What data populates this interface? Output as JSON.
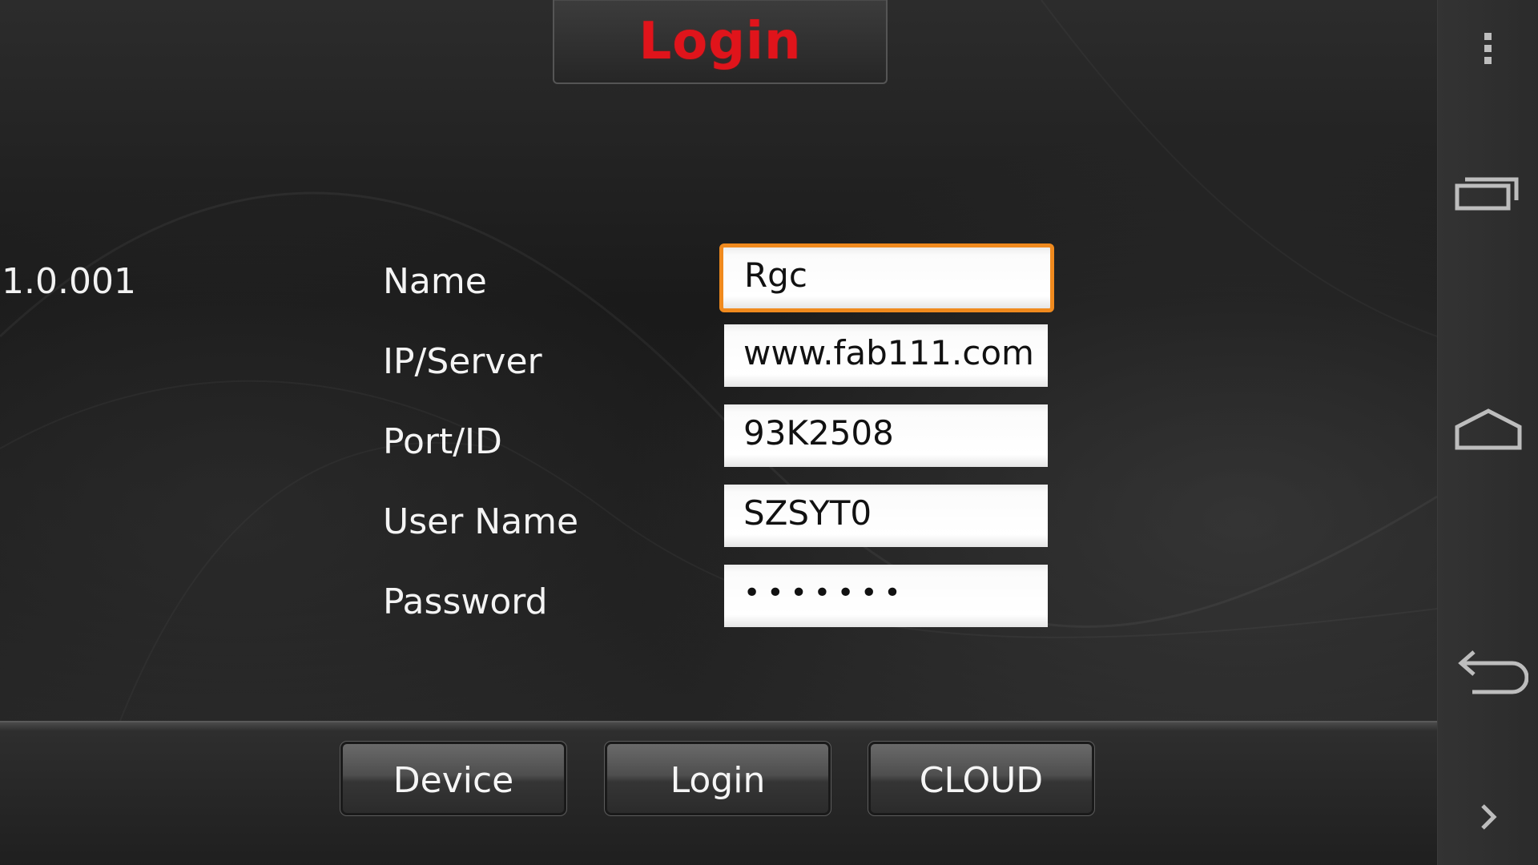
{
  "header": {
    "title": "Login"
  },
  "version": "1.0.001",
  "form": {
    "fields": [
      {
        "label": "Name",
        "value": "Rgc"
      },
      {
        "label": "IP/Server",
        "value": "www.fab111.com"
      },
      {
        "label": "Port/ID",
        "value": "93K2508"
      },
      {
        "label": "User Name",
        "value": "SZSYT0"
      },
      {
        "label": "Password",
        "value": "•••••••"
      }
    ],
    "focused_field": "Name"
  },
  "toolbar": {
    "device_label": "Device",
    "login_label": "Login",
    "cloud_label": "CLOUD"
  },
  "system_nav": {
    "icons": [
      "more-vertical-icon",
      "recent-apps-icon",
      "home-icon",
      "back-icon",
      "chevron-right-icon"
    ]
  },
  "colors": {
    "title_red": "#e0141b",
    "focus_orange": "#f08a1e",
    "background": "#1e1e1e"
  }
}
